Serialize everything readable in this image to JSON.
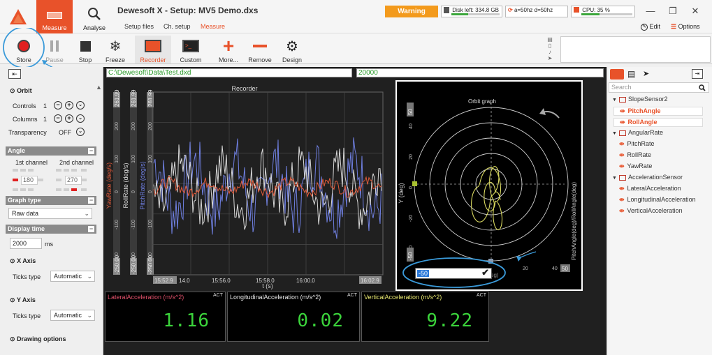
{
  "app": {
    "title": "Dewesoft X - Setup: MV5 Demo.dxs",
    "tiles": {
      "measure": "Measure",
      "analyse": "Analyse"
    },
    "tabs": [
      "Setup files",
      "Ch. setup",
      "Measure"
    ],
    "warning": "Warning",
    "status": {
      "disk": "Disk left: 334.8 GB",
      "rate": "a=50hz d=50hz",
      "cpu": "CPU: 35 %"
    },
    "edit": "Edit",
    "options": "Options",
    "disk_used_fraction": 0.35,
    "cpu_fraction": 0.35
  },
  "toolbar": [
    "Store",
    "Pause",
    "Stop",
    "Freeze",
    "Recorder",
    "Custom",
    "More...",
    "Remove",
    "Design"
  ],
  "left_panel": {
    "orbit": {
      "title": "Orbit",
      "controls_label": "Controls",
      "controls_value": "1",
      "columns_label": "Columns",
      "columns_value": "1",
      "transparency_label": "Transparency",
      "transparency_value": "OFF"
    },
    "angle": {
      "title": "Angle",
      "ch1_label": "1st channel",
      "ch2_label": "2nd channel",
      "ch1_value": "180",
      "ch2_value": "270"
    },
    "graph_type": {
      "title": "Graph type",
      "value": "Raw data"
    },
    "display_time": {
      "title": "Display time",
      "value": "2000",
      "unit": "ms"
    },
    "x_axis": {
      "title": "X Axis",
      "ticks_label": "Ticks type",
      "ticks_value": "Automatic"
    },
    "y_axis": {
      "title": "Y Axis",
      "ticks_label": "Ticks type",
      "ticks_value": "Automatic"
    },
    "drawing": {
      "title": "Drawing options"
    }
  },
  "path": "C:\\Dewesoft\\Data\\Test.dxd",
  "sample_value": "20000",
  "recorder": {
    "title": "Recorder",
    "xlabel": "t (s)",
    "axes": [
      {
        "label": "YawRate (deg/s)",
        "top": "261.99",
        "bottom": "-250.00",
        "ticks": [
          "200",
          "100",
          "0",
          "-100",
          "-200"
        ],
        "color": "#e05a3a"
      },
      {
        "label": "RollRate (deg/s)",
        "top": "261.99",
        "bottom": "-250.00",
        "ticks": [
          "200",
          "100",
          "0",
          "-100",
          "-200"
        ],
        "color": "#d8d8d8"
      },
      {
        "label": "PitchRate (deg/s)",
        "top": "261.99",
        "bottom": "-250.00",
        "ticks": [
          "200",
          "100",
          "0",
          "-100",
          "-200"
        ],
        "color": "#6f7fe0"
      }
    ],
    "xticks": [
      "15:52.9",
      "14.0",
      "15:56.0",
      "15:58.0",
      "16:00.0",
      "16:02.9"
    ]
  },
  "orbit": {
    "title": "Orbit graph",
    "ylabel": "Y (deg)",
    "right_label": "PitchAngle(deg)/RollAngle(deg)",
    "y_top": "50",
    "y_ticks": [
      "40",
      "20",
      "0",
      "-20",
      "-40"
    ],
    "y_bottom": "-50",
    "x_ticks": [
      "20",
      "40"
    ],
    "x_right": "50",
    "input_value": "-50",
    "axis_hint": "eg)"
  },
  "meters": [
    {
      "name": "LateralAcceleration (m/s^2)",
      "value": "1.16",
      "act": "ACT",
      "color": "#e0506a"
    },
    {
      "name": "LongitudinalAcceleration (m/s^2)",
      "value": "0.02",
      "act": "ACT",
      "color": "#e8e8e8"
    },
    {
      "name": "VerticalAcceleration (m/s^2)",
      "value": "9.22",
      "act": "ACT",
      "color": "#e8e870"
    }
  ],
  "channels": {
    "search_placeholder": "Search",
    "groups": [
      {
        "name": "SlopeSensor2",
        "items": [
          {
            "name": "PitchAngle",
            "selected": true
          },
          {
            "name": "RollAngle",
            "selected": true
          }
        ]
      },
      {
        "name": "AngularRate",
        "items": [
          {
            "name": "PitchRate"
          },
          {
            "name": "RollRate"
          },
          {
            "name": "YawRate"
          }
        ]
      },
      {
        "name": "AccelerationSensor",
        "items": [
          {
            "name": "LateralAcceleration"
          },
          {
            "name": "LongitudinalAcceleration"
          },
          {
            "name": "VerticalAcceleration"
          }
        ]
      }
    ]
  },
  "colors": {
    "accent": "#e8522a",
    "warning": "#f39a1c",
    "digital": "#3bd43b",
    "highlight_ring": "#3a9ad9"
  }
}
